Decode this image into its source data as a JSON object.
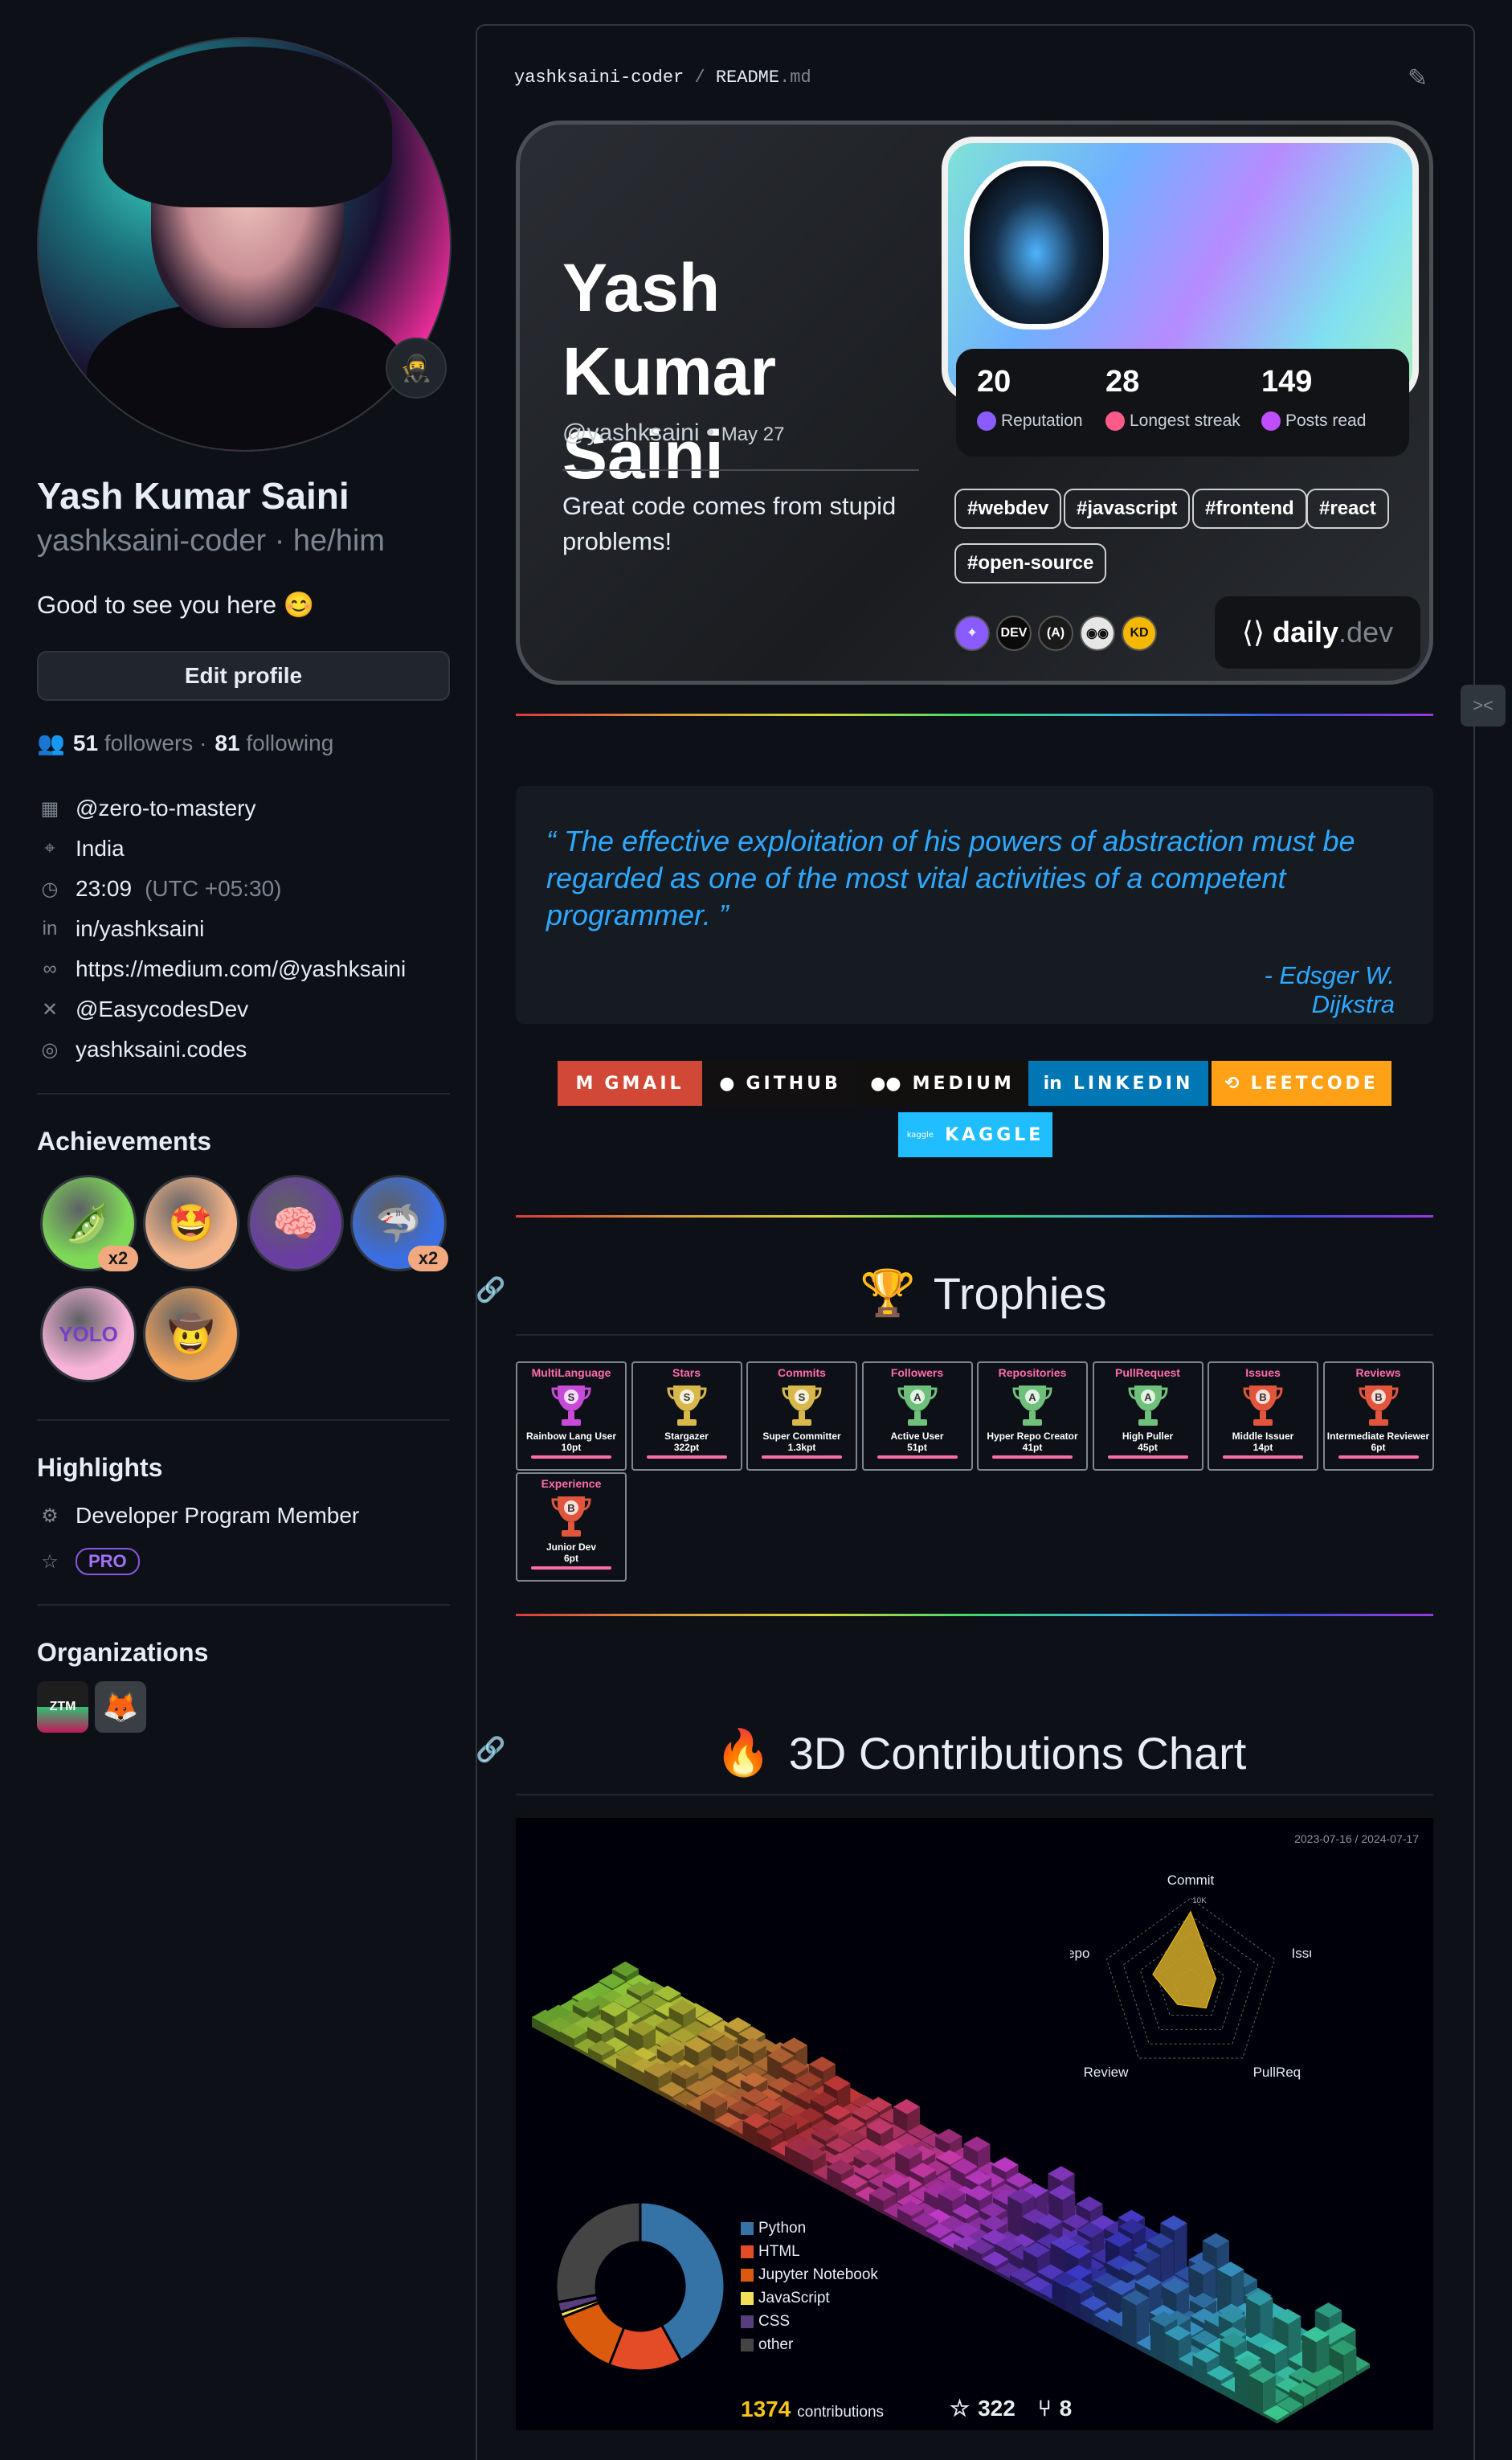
{
  "profile": {
    "name": "Yash Kumar Saini",
    "login_line": "yashksaini-coder · he/him",
    "bio": "Good to see you here 😊",
    "edit_button": "Edit profile",
    "followers_count": "51",
    "followers_label": "followers ·",
    "following_count": "81",
    "following_label": "following",
    "status_emoji": "🥷",
    "details": [
      {
        "icon": "organization-icon",
        "text": "@zero-to-mastery",
        "glyph": "▦"
      },
      {
        "icon": "location-icon",
        "text": "India",
        "glyph": "⌖"
      },
      {
        "icon": "clock-icon",
        "text": "23:09",
        "extra": "(UTC +05:30)",
        "glyph": "◷"
      },
      {
        "icon": "linkedin-icon",
        "text": "in/yashksaini",
        "glyph": "in"
      },
      {
        "icon": "link-icon",
        "text": "https://medium.com/@yashksaini",
        "glyph": "∞"
      },
      {
        "icon": "x-icon",
        "text": "@EasycodesDev",
        "glyph": "✕"
      },
      {
        "icon": "instagram-icon",
        "text": "yashksaini.codes",
        "glyph": "◎"
      }
    ]
  },
  "achievements": {
    "title": "Achievements",
    "badges": [
      {
        "name": "pair-extraordinaire-badge",
        "glyph": "🫛",
        "color": "#7ed957",
        "count": "x2"
      },
      {
        "name": "starstruck-badge",
        "glyph": "🤩",
        "color": "#f5b58a",
        "count": ""
      },
      {
        "name": "galaxy-brain-badge",
        "glyph": "🧠",
        "color": "#6a3ea1",
        "count": ""
      },
      {
        "name": "pull-shark-badge",
        "glyph": "🦈",
        "color": "#3b6ee0",
        "count": "x2"
      },
      {
        "name": "yolo-badge",
        "glyph": "YOLO",
        "color": "#f7b3d8",
        "count": ""
      },
      {
        "name": "quickdraw-badge",
        "glyph": "🤠",
        "color": "#f2a35b",
        "count": ""
      }
    ]
  },
  "highlights": {
    "title": "Highlights",
    "program": "Developer Program Member",
    "pro": "PRO"
  },
  "organizations": {
    "title": "Organizations",
    "items": [
      {
        "name": "ztm-org",
        "label": "ZTM"
      },
      {
        "name": "fox-org",
        "label": "🦊"
      }
    ]
  },
  "readme": {
    "path_user": "yashksaini-coder",
    "path_sep": "/",
    "path_file": "README",
    "path_ext": ".md"
  },
  "devcard": {
    "name": "Yash Kumar Saini",
    "handle": "@yashksaini",
    "joined": "May 27",
    "bio": "Great code comes from stupid problems!",
    "stats": [
      {
        "value": "20",
        "label": "Reputation",
        "color": "#8a5cff"
      },
      {
        "value": "28",
        "label": "Longest streak",
        "color": "#ff5b8a"
      },
      {
        "value": "149",
        "label": "Posts read",
        "color": "#c04dff"
      }
    ],
    "tags": [
      "#webdev",
      "#javascript",
      "#frontend",
      "#react",
      "#open-source"
    ],
    "squads": [
      {
        "label": "⌖",
        "color": "#8a5cff"
      },
      {
        "label": "DEV",
        "color": "#0a0a0a"
      },
      {
        "label": "(A)",
        "color": "#1a1a1a"
      },
      {
        "label": "◉◉",
        "color": "#e6e6e6"
      },
      {
        "label": "KD",
        "color": "#f5b800"
      }
    ],
    "brand": "daily",
    "brand_suffix": ".dev"
  },
  "quote": {
    "text": "“ The effective exploitation of his powers of abstraction must be regarded as one of the most vital activities of a competent programmer. ”",
    "author": "- Edsger W. Dijkstra"
  },
  "socials": [
    {
      "label": "GMAIL",
      "icon": "M",
      "color": "#d14836"
    },
    {
      "label": "GITHUB",
      "icon": "●",
      "color": "#121011"
    },
    {
      "label": "MEDIUM",
      "icon": "●●",
      "color": "#12100e"
    },
    {
      "label": "LINKEDIN",
      "icon": "in",
      "color": "#0077b5"
    },
    {
      "label": "LEETCODE",
      "icon": "⟲",
      "color": "#ffa116"
    },
    {
      "label": "KAGGLE",
      "icon": "kaggle",
      "color": "#20beff"
    }
  ],
  "trophies": {
    "title": "Trophies",
    "items": [
      {
        "title": "MultiLanguage",
        "rank": "S",
        "name": "Rainbow Lang User",
        "pts": "10pt",
        "color": "#c74bd8"
      },
      {
        "title": "Stars",
        "rank": "S",
        "name": "Stargazer",
        "pts": "322pt",
        "color": "#d8b84a"
      },
      {
        "title": "Commits",
        "rank": "S",
        "name": "Super Committer",
        "pts": "1.3kpt",
        "color": "#d8b84a"
      },
      {
        "title": "Followers",
        "rank": "A",
        "name": "Active User",
        "pts": "51pt",
        "color": "#6ec07a"
      },
      {
        "title": "Repositories",
        "rank": "A",
        "name": "Hyper Repo Creator",
        "pts": "41pt",
        "color": "#6ec07a"
      },
      {
        "title": "PullRequest",
        "rank": "A",
        "name": "High Puller",
        "pts": "45pt",
        "color": "#6ec07a"
      },
      {
        "title": "Issues",
        "rank": "B",
        "name": "Middle Issuer",
        "pts": "14pt",
        "color": "#e0553b"
      },
      {
        "title": "Reviews",
        "rank": "B",
        "name": "Intermediate Reviewer",
        "pts": "6pt",
        "color": "#e0553b"
      },
      {
        "title": "Experience",
        "rank": "B",
        "name": "Junior Dev",
        "pts": "6pt",
        "color": "#e0553b"
      }
    ]
  },
  "contrib": {
    "title": "3D Contributions Chart",
    "date_range": "2023-07-16 / 2024-07-17",
    "radar_labels": [
      "Commit",
      "Issue",
      "PullReq",
      "Review",
      "Repo"
    ],
    "radar_scale": "10K",
    "languages": [
      {
        "name": "Python",
        "color": "#3572a5"
      },
      {
        "name": "HTML",
        "color": "#e34c26"
      },
      {
        "name": "Jupyter Notebook",
        "color": "#da5b0b"
      },
      {
        "name": "JavaScript",
        "color": "#f1e05a"
      },
      {
        "name": "CSS",
        "color": "#563d7c"
      },
      {
        "name": "other",
        "color": "#444444"
      }
    ],
    "contributions": "1374",
    "contributions_label": "contributions",
    "stars": "322",
    "forks": "8"
  },
  "chart_data": {
    "type": "pie",
    "categories": [
      "Python",
      "HTML",
      "Jupyter Notebook",
      "JavaScript",
      "CSS",
      "other"
    ],
    "values": [
      42,
      14,
      13,
      1,
      2,
      28
    ],
    "radar": {
      "type": "radar",
      "categories": [
        "Commit",
        "Issue",
        "PullReq",
        "Review",
        "Repo"
      ],
      "values": [
        0.85,
        0.3,
        0.3,
        0.25,
        0.45
      ]
    }
  }
}
